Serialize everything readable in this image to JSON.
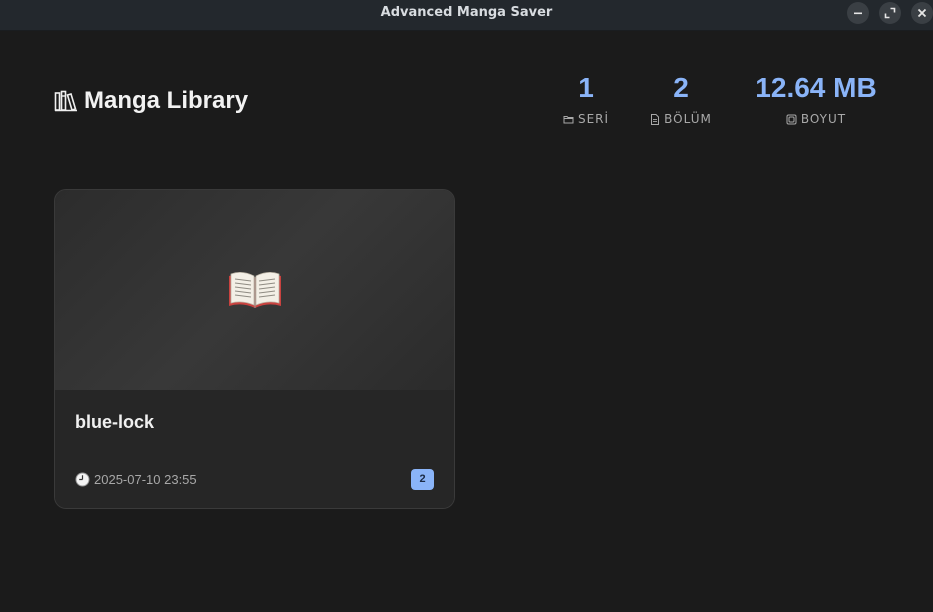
{
  "window": {
    "title": "Advanced Manga Saver"
  },
  "header": {
    "title": "Manga Library",
    "icon": "books-icon"
  },
  "stats": [
    {
      "value": "1",
      "label": "SERİ",
      "icon": "folder-icon"
    },
    {
      "value": "2",
      "label": "BÖLÜM",
      "icon": "document-icon"
    },
    {
      "value": "12.64 MB",
      "label": "BOYUT",
      "icon": "disk-icon"
    }
  ],
  "cards": [
    {
      "name": "blue-lock",
      "date": "2025-07-10 23:55",
      "chapter_count": "2",
      "cover_icon": "open-book-icon"
    }
  ],
  "colors": {
    "accent": "#8ab4f8",
    "background": "#1b1b1b",
    "titlebar": "#23282d",
    "card": "#252525"
  }
}
